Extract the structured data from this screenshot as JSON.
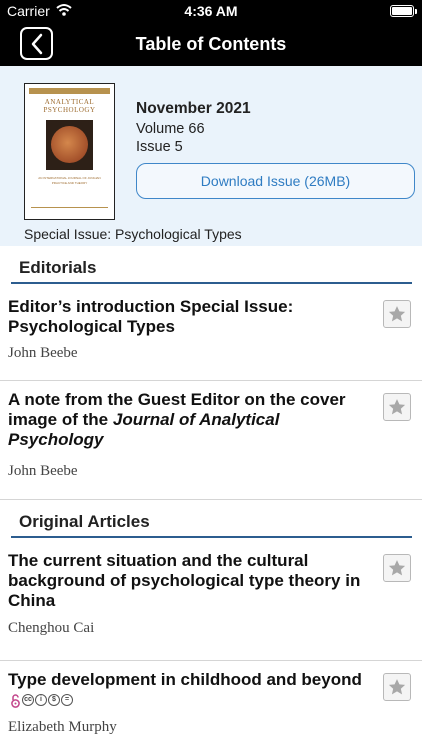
{
  "status_bar": {
    "carrier": "Carrier",
    "time": "4:36 AM"
  },
  "nav": {
    "title": "Table of Contents"
  },
  "issue": {
    "cover": {
      "journal_top": "ANALYTICAL",
      "journal_bottom": "PSYCHOLOGY",
      "subtitle": "AN INTERNATIONAL JOURNAL OF JUNGIAN PRACTICE AND THEORY"
    },
    "month": "November 2021",
    "volume": "Volume 66",
    "issue": "Issue 5",
    "download_label": "Download Issue (26MB)",
    "special": "Special Issue: Psychological Types"
  },
  "sections": [
    {
      "label": "Editorials",
      "articles": [
        {
          "title": "Editor’s introduction Special Issue: Psychological Types",
          "author": "John Beebe"
        },
        {
          "title_pre": "A note from the Guest Editor on the cover image of the ",
          "title_italic": "Journal of Analytical Psychology",
          "author": "John Beebe"
        }
      ]
    },
    {
      "label": "Original Articles",
      "articles": [
        {
          "title": "The current situation and the cultural background of psychological type theory in China",
          "author": "Chenghou Cai"
        },
        {
          "title": "Type development in childhood and beyond",
          "author": "Elizabeth Murphy",
          "badges": [
            "open-access-icon",
            "cc-icon",
            "by-icon",
            "nc-icon",
            "nd-icon"
          ]
        }
      ]
    }
  ]
}
